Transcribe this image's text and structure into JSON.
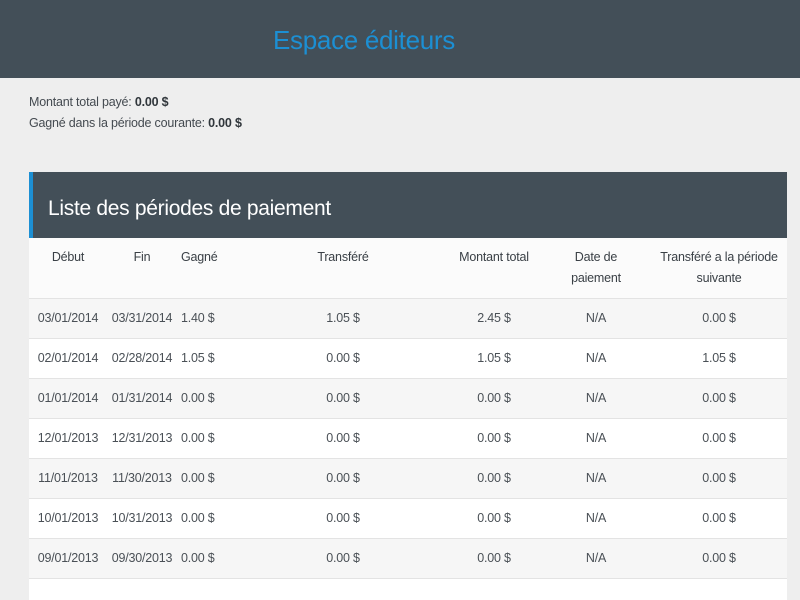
{
  "header": {
    "title": "Espace éditeurs"
  },
  "summary": {
    "total_paid_label": "Montant total payé:",
    "total_paid_value": "0.00 $",
    "current_period_label": "Gagné dans la période courante:",
    "current_period_value": "0.00 $"
  },
  "panel": {
    "title": "Liste des périodes de paiement"
  },
  "table": {
    "columns": {
      "debut": "Début",
      "fin": "Fin",
      "gagne": "Gagné",
      "transfere": "Transféré",
      "montant_total": "Montant total",
      "date_paiement_1": "Date de",
      "date_paiement_2": "paiement",
      "transfere_suivante_1": "Transféré a la période",
      "transfere_suivante_2": "suivante"
    },
    "rows": [
      {
        "debut": "03/01/2014",
        "fin": "03/31/2014",
        "gagne": "1.40 $",
        "transfere": "1.05 $",
        "total": "2.45 $",
        "date": "N/A",
        "suivante": "0.00 $"
      },
      {
        "debut": "02/01/2014",
        "fin": "02/28/2014",
        "gagne": "1.05 $",
        "transfere": "0.00 $",
        "total": "1.05 $",
        "date": "N/A",
        "suivante": "1.05 $"
      },
      {
        "debut": "01/01/2014",
        "fin": "01/31/2014",
        "gagne": "0.00 $",
        "transfere": "0.00 $",
        "total": "0.00 $",
        "date": "N/A",
        "suivante": "0.00 $"
      },
      {
        "debut": "12/01/2013",
        "fin": "12/31/2013",
        "gagne": "0.00 $",
        "transfere": "0.00 $",
        "total": "0.00 $",
        "date": "N/A",
        "suivante": "0.00 $"
      },
      {
        "debut": "11/01/2013",
        "fin": "11/30/2013",
        "gagne": "0.00 $",
        "transfere": "0.00 $",
        "total": "0.00 $",
        "date": "N/A",
        "suivante": "0.00 $"
      },
      {
        "debut": "10/01/2013",
        "fin": "10/31/2013",
        "gagne": "0.00 $",
        "transfere": "0.00 $",
        "total": "0.00 $",
        "date": "N/A",
        "suivante": "0.00 $"
      },
      {
        "debut": "09/01/2013",
        "fin": "09/30/2013",
        "gagne": "0.00 $",
        "transfere": "0.00 $",
        "total": "0.00 $",
        "date": "N/A",
        "suivante": "0.00 $"
      }
    ]
  },
  "colors": {
    "header_bg": "#434f58",
    "accent": "#1c8fd3",
    "page_bg": "#eeeeee"
  }
}
